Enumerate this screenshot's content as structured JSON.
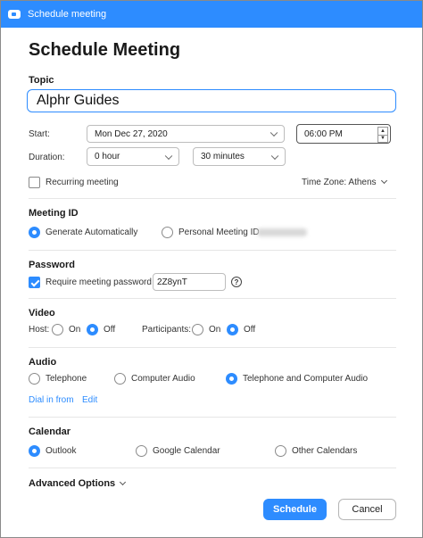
{
  "window": {
    "title": "Schedule meeting",
    "heading": "Schedule Meeting"
  },
  "topic": {
    "label": "Topic",
    "value": "Alphr Guides"
  },
  "start": {
    "label": "Start:",
    "day": "Mon",
    "month": "Dec",
    "date": "27, 2020",
    "time": "06:00 PM"
  },
  "duration": {
    "label": "Duration:",
    "hours": "0 hour",
    "minutes": "30 minutes"
  },
  "recurring": {
    "label": "Recurring meeting",
    "checked": false
  },
  "timezone": {
    "label": "Time Zone: Athens"
  },
  "meeting_id": {
    "label": "Meeting ID",
    "option_auto": "Generate Automatically",
    "option_personal": "Personal Meeting ID",
    "selected": "auto"
  },
  "password": {
    "label": "Password",
    "require_label": "Require meeting password",
    "checked": true,
    "value": "2Z8ynT",
    "help": "?"
  },
  "video": {
    "label": "Video",
    "host_label": "Host:",
    "participants_label": "Participants:",
    "on": "On",
    "off": "Off",
    "host": "off",
    "participants": "off"
  },
  "audio": {
    "label": "Audio",
    "options": [
      "Telephone",
      "Computer Audio",
      "Telephone and Computer Audio"
    ],
    "selected": "Telephone and Computer Audio",
    "dial_in": "Dial in from",
    "edit": "Edit"
  },
  "calendar": {
    "label": "Calendar",
    "options": [
      "Outlook",
      "Google Calendar",
      "Other Calendars"
    ],
    "selected": "Outlook"
  },
  "advanced": {
    "label": "Advanced Options"
  },
  "actions": {
    "schedule": "Schedule",
    "cancel": "Cancel"
  },
  "colors": {
    "accent": "#2d8cff"
  }
}
